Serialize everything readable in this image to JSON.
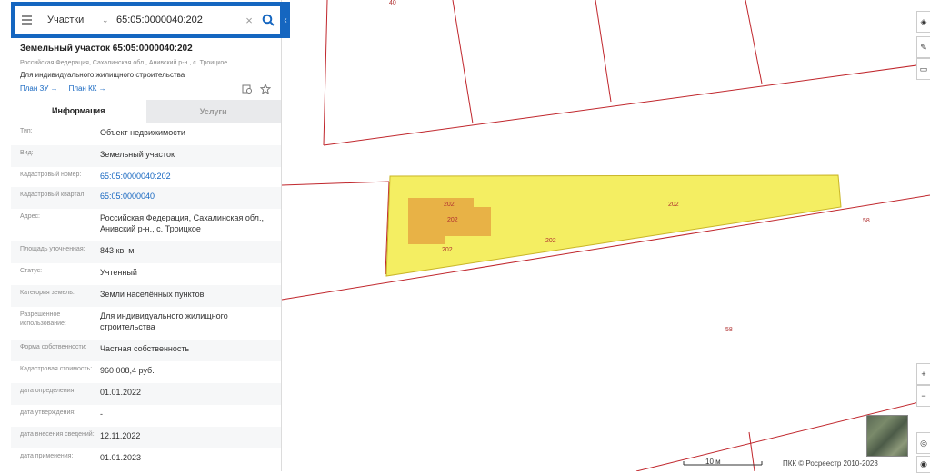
{
  "search": {
    "category": "Участки",
    "query": "65:05:0000040:202"
  },
  "parcel": {
    "title": "Земельный участок 65:05:0000040:202",
    "address_short": "Российская Федерация, Сахалинская обл., Анивский р-н., с. Троицкое",
    "purpose": "Для индивидуального жилищного строительства",
    "plan_zu": "План ЗУ →",
    "plan_kk": "План КК →"
  },
  "tabs": {
    "info": "Информация",
    "services": "Услуги"
  },
  "rows": [
    {
      "label": "Тип:",
      "value": "Объект недвижимости"
    },
    {
      "label": "Вид:",
      "value": "Земельный участок"
    },
    {
      "label": "Кадастровый номер:",
      "value": "65:05:0000040:202"
    },
    {
      "label": "Кадастровый квартал:",
      "value": "65:05:0000040"
    },
    {
      "label": "Адрес:",
      "value": "Российская Федерация, Сахалинская обл., Анивский р-н., с. Троицкое"
    },
    {
      "label": "Площадь уточненная:",
      "value": "843 кв. м"
    },
    {
      "label": "Статус:",
      "value": "Учтенный"
    },
    {
      "label": "Категория земель:",
      "value": "Земли населённых пунктов"
    },
    {
      "label": "Разрешенное использование:",
      "value": "Для индивидуального жилищного строительства"
    },
    {
      "label": "Форма собственности:",
      "value": "Частная собственность"
    },
    {
      "label": "Кадастровая стоимость:",
      "value": "960 008,4 руб."
    },
    {
      "label": "дата определения:",
      "value": "01.01.2022"
    },
    {
      "label": "дата утверждения:",
      "value": "-"
    },
    {
      "label": "дата внесения сведений:",
      "value": "12.11.2022"
    },
    {
      "label": "дата применения:",
      "value": "01.01.2023"
    }
  ],
  "map": {
    "labels": [
      "40",
      "202",
      "202",
      "202",
      "202",
      "202",
      "58",
      "58"
    ],
    "scale": "10 м",
    "copyright": "ПКК © Росреестр 2010-2023",
    "colors": {
      "boundary": "#c0262c",
      "parcel_fill": "#f4ee62",
      "building_fill": "#e8b246",
      "accent": "#1566c0"
    }
  }
}
